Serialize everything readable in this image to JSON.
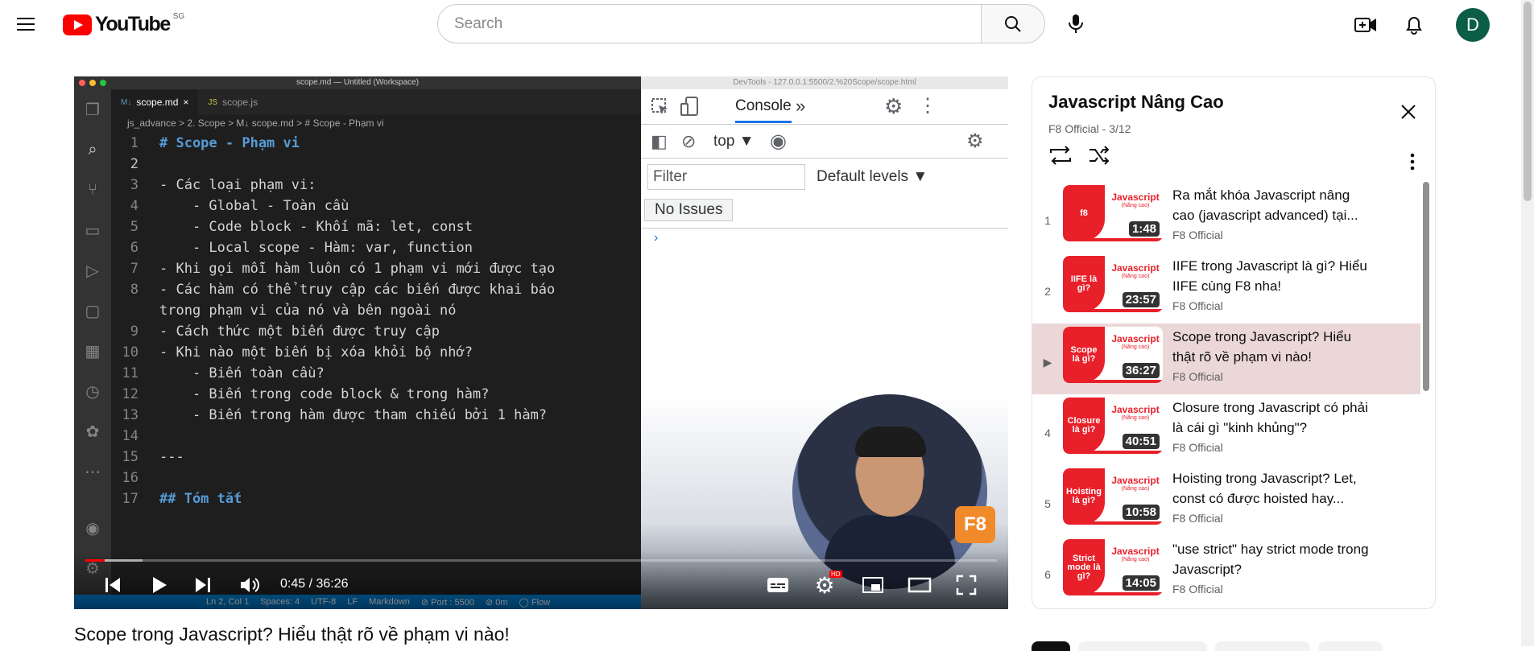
{
  "header": {
    "logo_text": "YouTube",
    "region": "SG",
    "search_placeholder": "Search",
    "avatar_letter": "D"
  },
  "video": {
    "title": "Scope trong Javascript? Hiểu thật rõ về phạm vi nào!",
    "current_time": "0:45",
    "duration": "36:26",
    "time_display": "0:45 / 36:26",
    "played_fraction": 0.021,
    "loaded_fraction": 0.063,
    "hd_badge": "HD",
    "f8_badge": "F8"
  },
  "vscode": {
    "window_title": "scope.md — Untitled (Workspace)",
    "tabs": [
      {
        "badge": "M↓",
        "label": "scope.md",
        "active": true
      },
      {
        "badge": "JS",
        "label": "scope.js",
        "active": false
      }
    ],
    "breadcrumb": "js_advance > 2. Scope > M↓ scope.md > # Scope - Phạm vi",
    "lines": [
      {
        "n": "1",
        "text": "# Scope - Phạm vi",
        "heading": true
      },
      {
        "n": "2",
        "text": "",
        "heading": false
      },
      {
        "n": "3",
        "text": "- Các loại phạm vi:",
        "heading": false
      },
      {
        "n": "4",
        "text": "    - Global - Toàn cầu",
        "heading": false
      },
      {
        "n": "5",
        "text": "    - Code block - Khối mã: let, const",
        "heading": false
      },
      {
        "n": "6",
        "text": "    - Local scope - Hàm: var, function",
        "heading": false
      },
      {
        "n": "7",
        "text": "- Khi gọi mỗi hàm luôn có 1 phạm vi mới được tạo",
        "heading": false
      },
      {
        "n": "8",
        "text": "- Các hàm có thể truy cập các biến được khai báo",
        "heading": false
      },
      {
        "n": "",
        "text": "trong phạm vi của nó và bên ngoài nó",
        "heading": false
      },
      {
        "n": "9",
        "text": "- Cách thức một biến được truy cập",
        "heading": false
      },
      {
        "n": "10",
        "text": "- Khi nào một biến bị xóa khỏi bộ nhớ?",
        "heading": false
      },
      {
        "n": "11",
        "text": "    - Biến toàn cầu?",
        "heading": false
      },
      {
        "n": "12",
        "text": "    - Biến trong code block & trong hàm?",
        "heading": false
      },
      {
        "n": "13",
        "text": "    - Biến trong hàm được tham chiếu bởi 1 hàm?",
        "heading": false
      },
      {
        "n": "14",
        "text": "",
        "heading": false
      },
      {
        "n": "15",
        "text": "---",
        "heading": false
      },
      {
        "n": "16",
        "text": "",
        "heading": false
      },
      {
        "n": "17",
        "text": "## Tóm tắt",
        "heading": true
      }
    ],
    "status": [
      "Ln 2, Col 1",
      "Spaces: 4",
      "UTF-8",
      "LF",
      "Markdown",
      "⊘ Port : 5500",
      "⊘ 0m",
      "◯ Flow"
    ]
  },
  "devtools": {
    "window_title": "DevTools - 127.0.0.1:5500/2.%20Scope/scope.html",
    "tab_console": "Console",
    "context": "top",
    "filter_placeholder": "Filter",
    "levels": "Default levels ▼",
    "no_issues": "No Issues",
    "prompt": "›"
  },
  "playlist": {
    "title": "Javascript Nâng Cao",
    "subtitle": "F8 Official - 3/12",
    "items": [
      {
        "index": "1",
        "title": "Ra mắt khóa Javascript nâng cao (javascript advanced) tại...",
        "channel": "F8 Official",
        "duration": "1:48",
        "thumb_label": "f8",
        "active": false
      },
      {
        "index": "2",
        "title": "IIFE trong Javascript là gì? Hiểu IIFE cùng F8 nha!",
        "channel": "F8 Official",
        "duration": "23:57",
        "thumb_label": "IIFE là gì?",
        "active": false
      },
      {
        "index": "▶",
        "title": "Scope trong Javascript? Hiểu thật rõ về phạm vi nào!",
        "channel": "F8 Official",
        "duration": "36:27",
        "thumb_label": "Scope là gì?",
        "active": true
      },
      {
        "index": "4",
        "title": "Closure trong Javascript có phải là cái gì \"kinh khủng\"?",
        "channel": "F8 Official",
        "duration": "40:51",
        "thumb_label": "Closure là gì?",
        "active": false
      },
      {
        "index": "5",
        "title": "Hoisting trong Javascript? Let, const có được hoisted hay...",
        "channel": "F8 Official",
        "duration": "10:58",
        "thumb_label": "Hoisting là gì?",
        "active": false
      },
      {
        "index": "6",
        "title": "\"use strict\" hay strict mode trong Javascript?",
        "channel": "F8 Official",
        "duration": "14:05",
        "thumb_label": "Strict mode là gì?",
        "active": false
      }
    ],
    "thumb_brand": "Javascript",
    "thumb_brand_sub": "(Nâng cao)"
  },
  "colors": {
    "yt_red": "#ff0000",
    "vscode_bg": "#1e1e1e",
    "vscode_status": "#007acc",
    "playlist_active": "#ecd7d8",
    "avatar_bg": "#0b5d45"
  }
}
